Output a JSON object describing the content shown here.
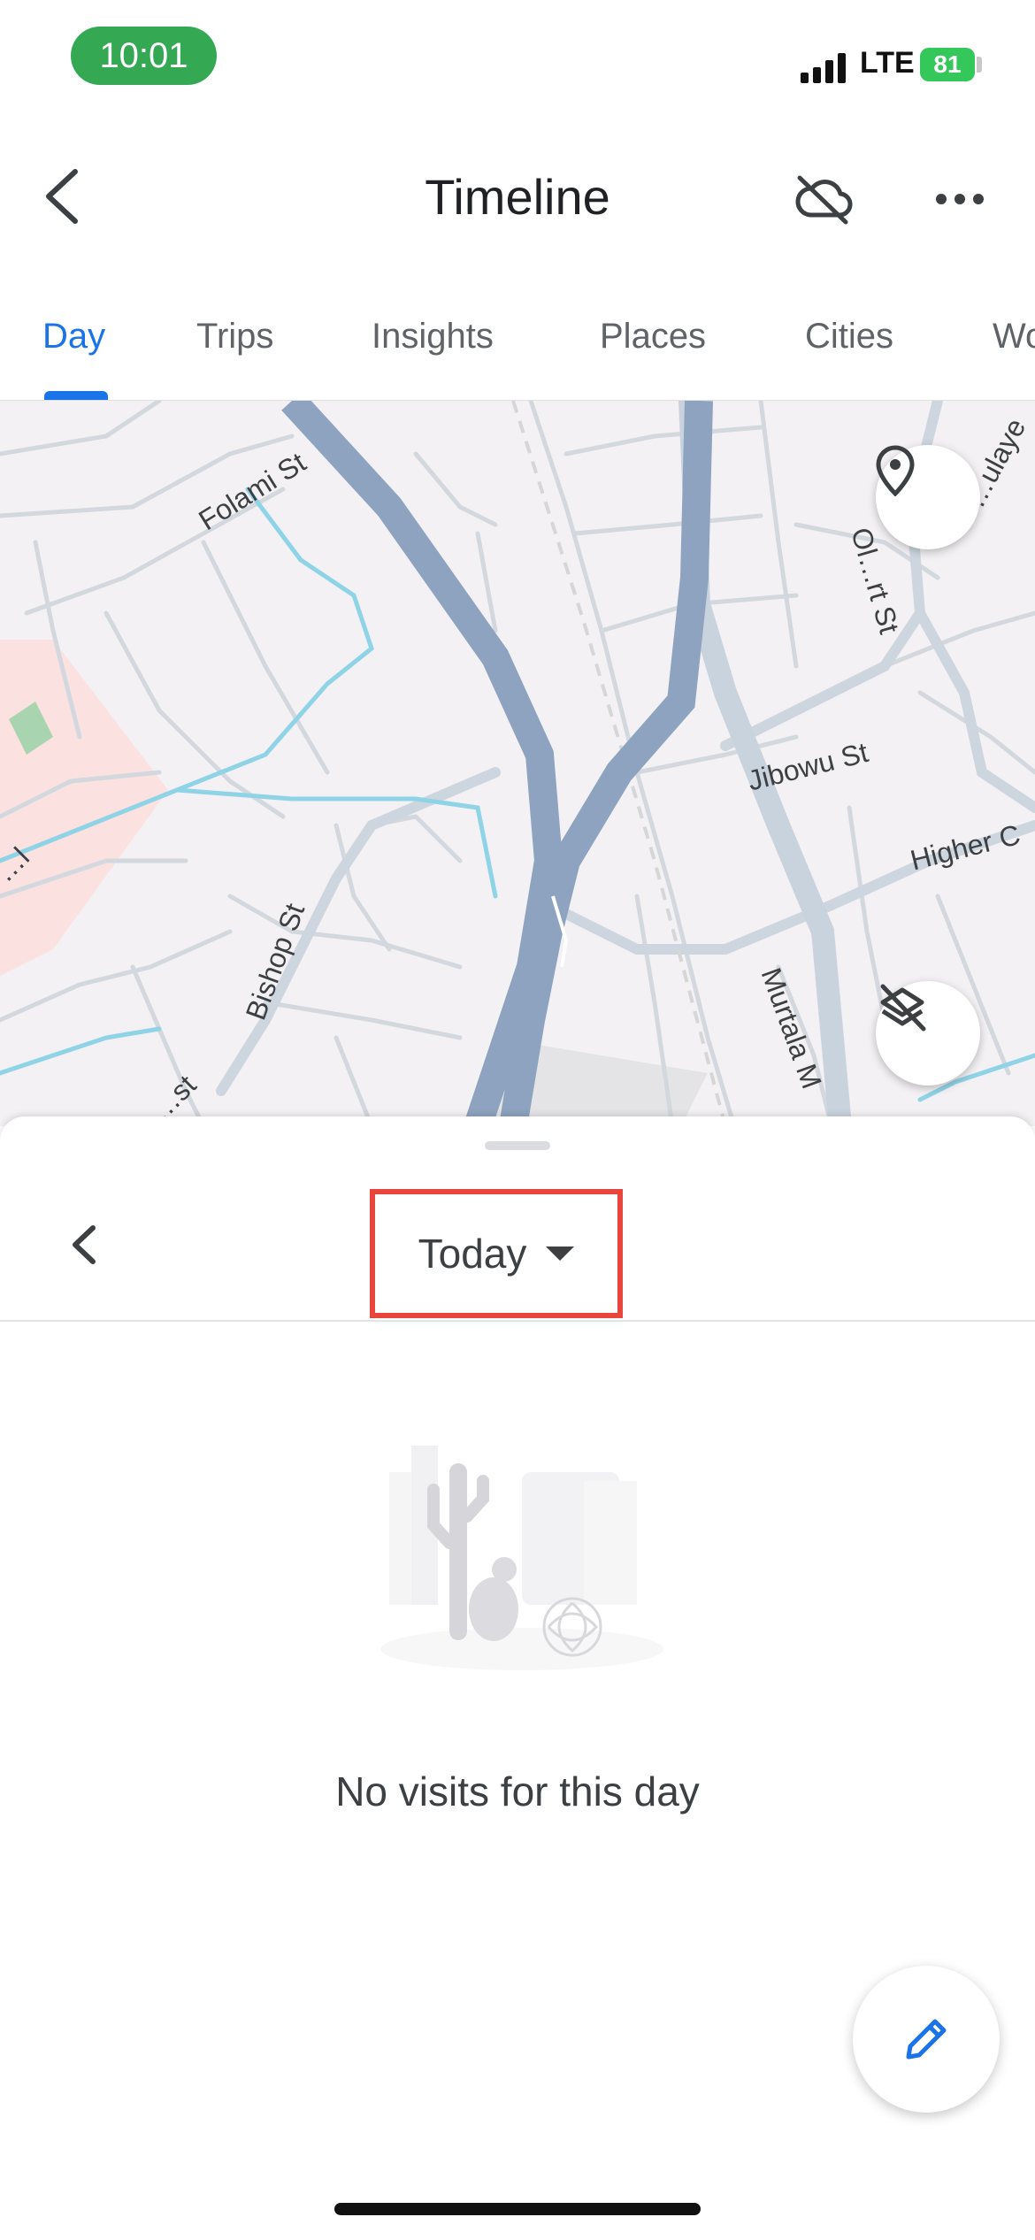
{
  "status_bar": {
    "time": "10:01",
    "carrier": "LTE",
    "battery": "81"
  },
  "header": {
    "title": "Timeline",
    "icons": {
      "back": "back-arrow-icon",
      "cloud": "cloud-off-icon",
      "more": "more-horizontal-icon"
    }
  },
  "tabs": [
    {
      "label": "Day",
      "active": true
    },
    {
      "label": "Trips"
    },
    {
      "label": "Insights"
    },
    {
      "label": "Places"
    },
    {
      "label": "Cities"
    },
    {
      "label": "Wo"
    }
  ],
  "map": {
    "streets": [
      "Folami St",
      "Bishop St",
      "Jibowu St",
      "Higher C",
      "Murtala M",
      "Ol…rt St",
      "…ulaye",
      "…l",
      "…st"
    ],
    "buttons": {
      "location": "location-pin-icon",
      "layers": "layers-off-icon"
    }
  },
  "sheet": {
    "date_label": "Today",
    "empty_message": "No visits for this day"
  },
  "colors": {
    "accent": "#1a73e8",
    "highlight_box": "#e8453c",
    "status_pill": "#34a853",
    "battery": "#34c759"
  }
}
